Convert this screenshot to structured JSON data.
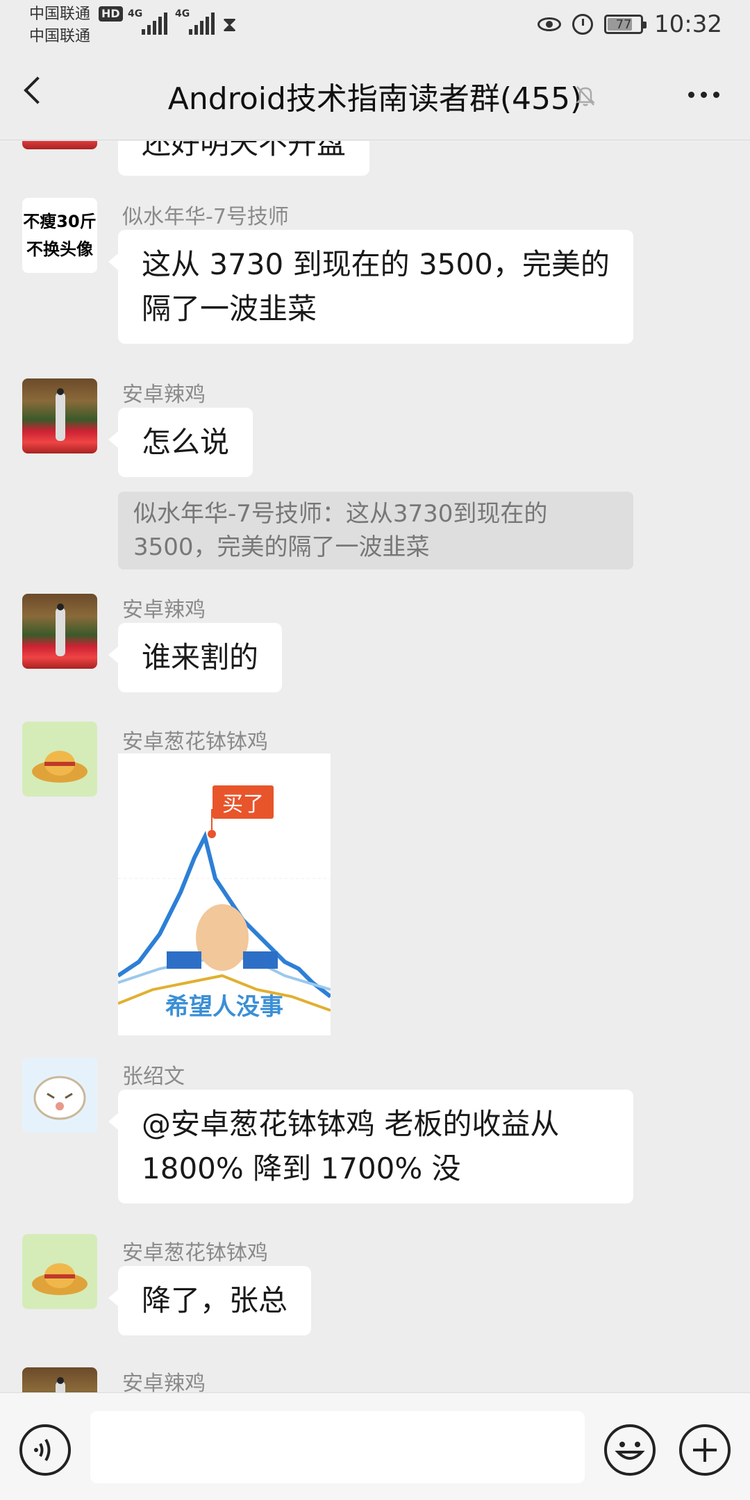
{
  "status_bar": {
    "carrier1": "中国联通",
    "carrier1_badge": "HD",
    "carrier2": "中国联通",
    "signal1_label": "4G",
    "signal2_label": "4G",
    "battery": "77",
    "time": "10:32"
  },
  "header": {
    "title": "Android技术指南读者群(455)"
  },
  "messages": [
    {
      "id": "m0",
      "text": "还好明天不开盘"
    },
    {
      "id": "m1",
      "sender": "似水年华-7号技师",
      "avatar_text": [
        "不瘦30斤",
        "不换头像"
      ],
      "text_line1": "这从 3730 到现在的 3500，完美的",
      "text_line2": "隔了一波韭菜"
    },
    {
      "id": "m2",
      "sender": "安卓辣鸡",
      "text": "怎么说",
      "quote_line1": "似水年华-7号技师：这从3730到现在的",
      "quote_line2": "3500，完美的隔了一波韭菜"
    },
    {
      "id": "m3",
      "sender": "安卓辣鸡",
      "text": "谁来割的"
    },
    {
      "id": "m4",
      "sender": "安卓葱花钵钵鸡",
      "sticker_tag": "买了",
      "sticker_caption": "希望人没事"
    },
    {
      "id": "m5",
      "sender": "张绍文",
      "text_line1": "@安卓葱花钵钵鸡  老板的收益从",
      "text_line2": "1800% 降到 1700% 没"
    },
    {
      "id": "m6",
      "sender": "安卓葱花钵钵鸡",
      "text": "降了，张总"
    },
    {
      "id": "m7",
      "sender": "安卓辣鸡"
    }
  ],
  "icons": {
    "back": "chevron-left-icon",
    "mute": "bell-off-icon",
    "more": "more-icon",
    "voice": "voice-icon",
    "emoji": "emoji-icon",
    "plus": "plus-icon"
  }
}
